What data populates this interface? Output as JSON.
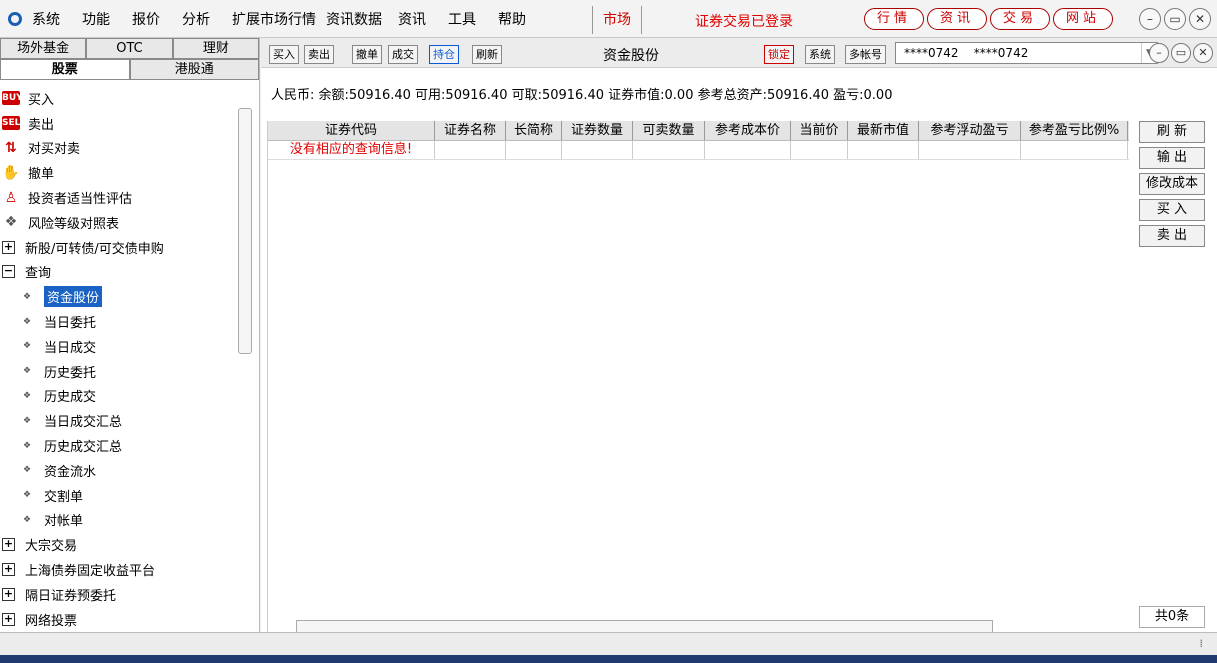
{
  "menubar": {
    "items": [
      "系统",
      "功能",
      "报价",
      "分析",
      "扩展市场行情",
      "资讯数据",
      "资讯",
      "工具",
      "帮助"
    ],
    "market_tab": "市场",
    "login_status": "证券交易已登录",
    "top_buttons": [
      "行情",
      "资讯",
      "交易",
      "网站"
    ]
  },
  "left_panel": {
    "cat_row1": [
      "场外基金",
      "OTC",
      "理财"
    ],
    "cat_row2": [
      "股票",
      "港股通"
    ],
    "tree": [
      {
        "label": "买入",
        "icon": "buy-icon"
      },
      {
        "label": "卖出",
        "icon": "sell-icon"
      },
      {
        "label": "对买对卖",
        "icon": "swap-icon"
      },
      {
        "label": "撤单",
        "icon": "hand-icon"
      },
      {
        "label": "投资者适当性评估",
        "icon": "person-icon"
      },
      {
        "label": "风险等级对照表",
        "icon": "diamond-icon"
      },
      {
        "label": "新股/可转债/可交债申购",
        "icon": "expand-icon"
      },
      {
        "label": "查询",
        "icon": "collapse-icon"
      },
      {
        "label": "资金股份",
        "icon": "diamond-icon",
        "selected": true
      },
      {
        "label": "当日委托",
        "icon": "diamond-icon"
      },
      {
        "label": "当日成交",
        "icon": "diamond-icon"
      },
      {
        "label": "历史委托",
        "icon": "diamond-icon"
      },
      {
        "label": "历史成交",
        "icon": "diamond-icon"
      },
      {
        "label": "当日成交汇总",
        "icon": "diamond-icon"
      },
      {
        "label": "历史成交汇总",
        "icon": "diamond-icon"
      },
      {
        "label": "资金流水",
        "icon": "diamond-icon"
      },
      {
        "label": "交割单",
        "icon": "diamond-icon"
      },
      {
        "label": "对帐单",
        "icon": "diamond-icon"
      },
      {
        "label": "大宗交易",
        "icon": "expand-icon"
      },
      {
        "label": "上海债券固定收益平台",
        "icon": "expand-icon"
      },
      {
        "label": "隔日证券预委托",
        "icon": "expand-icon"
      },
      {
        "label": "网络投票",
        "icon": "expand-icon"
      }
    ]
  },
  "toolbar": {
    "buttons": [
      "买入",
      "卖出",
      "撤单",
      "成交",
      "持仓",
      "刷新"
    ],
    "title": "资金股份",
    "lock": "锁定",
    "system": "系统",
    "multi_account": "多帐号",
    "account_value": "****0742    ****0742"
  },
  "summary": {
    "text": "人民币: 余额:50916.40  可用:50916.40  可取:50916.40  证券市值:0.00  参考总资产:50916.40  盈亏:0.00"
  },
  "grid": {
    "columns": [
      "证券代码",
      "证券名称",
      "长简称",
      "证券数量",
      "可卖数量",
      "参考成本价",
      "当前价",
      "最新市值",
      "参考浮动盈亏",
      "参考盈亏比例%"
    ],
    "empty_message": "没有相应的查询信息!"
  },
  "side_buttons": [
    "刷 新",
    "输 出",
    "修改成本",
    "买 入",
    "卖 出"
  ],
  "total_count": "共0条"
}
